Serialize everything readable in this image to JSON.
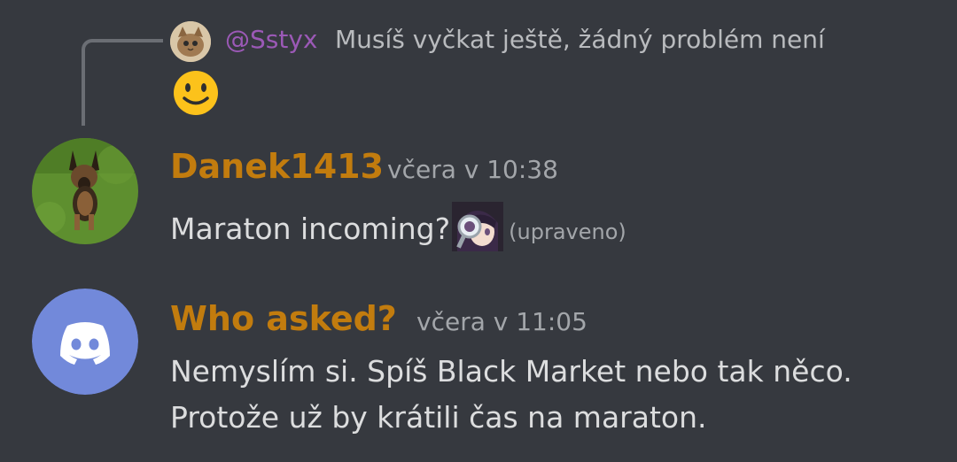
{
  "reply": {
    "author": "@Sstyx",
    "text": "Musíš vyčkat ještě, žádný problém není",
    "emoji": "slightly-smiling-face-icon"
  },
  "messages": [
    {
      "author": "Danek1413",
      "timestamp": "včera v 10:38",
      "text": "Maraton incoming?",
      "edited_label": "(upraveno)",
      "avatar": "german-shepherd-puppy-avatar",
      "inline_emoji": "anime-magnifying-glass-emoji"
    },
    {
      "author": "Who asked?",
      "timestamp": "včera v 11:05",
      "lines": [
        "Nemyslím si. Spíš Black Market nebo tak něco.",
        "Protože už by krátili čas na maraton."
      ],
      "avatar": "discord-default-avatar"
    }
  ],
  "colors": {
    "background": "#36393f",
    "author": "#c27c0e",
    "reply_author": "#9b59b6",
    "timestamp": "#a3a6aa",
    "text": "#dcddde",
    "discord_blurple": "#7289da"
  }
}
